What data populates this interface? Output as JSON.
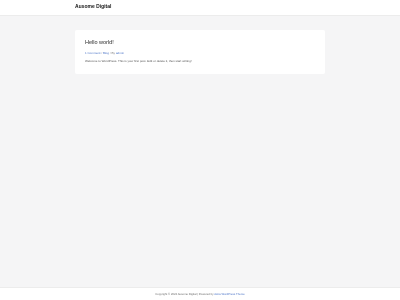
{
  "header": {
    "site_title": "Ausome Digital"
  },
  "post": {
    "title": "Hello world!",
    "meta": {
      "comments": "1 Comment",
      "category": "Blog",
      "author": "admin",
      "separator": "/",
      "by_label": "By"
    },
    "content": "Welcome to WordPress. This is your first post. Edit or delete it, then start writing!"
  },
  "footer": {
    "copyright": "Copyright © 2024 Ausome Digital | Powered by",
    "theme_link": "Astra WordPress Theme"
  },
  "colors": {
    "background": "#f5f5f6",
    "link": "#4b74c7",
    "card": "#ffffff"
  }
}
